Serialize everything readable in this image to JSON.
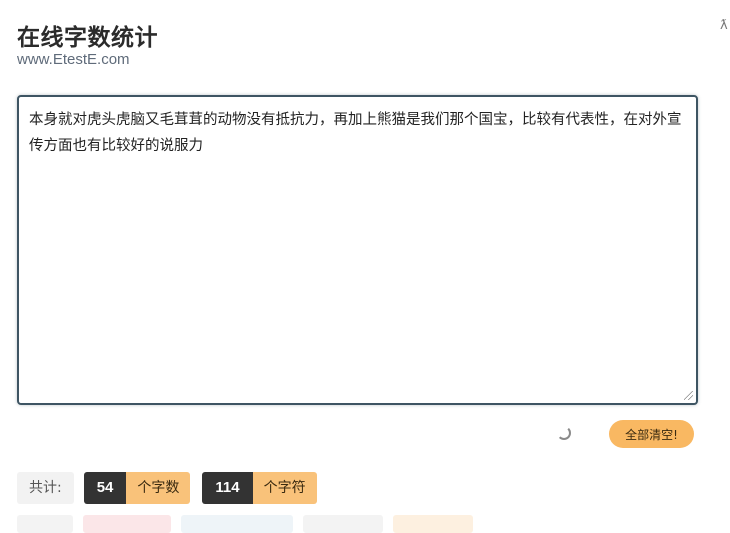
{
  "header": {
    "title": "在线字数统计",
    "subtitle": "www.EtestE.com",
    "corner_glyph": "ƛ"
  },
  "editor": {
    "text": "本身就对虎头虎脑又毛茸茸的动物没有抵抗力，再加上熊猫是我们那个国宝，比较有代表性，在对外宣传方面也有比较好的说服力"
  },
  "actions": {
    "clear_label": "全部清空!"
  },
  "stats": {
    "total_label": "共计:",
    "char_count": "54",
    "char_unit": "个字数",
    "symbol_count": "114",
    "symbol_unit": "个字符"
  },
  "colors": {
    "accent": "#f9b862",
    "dark": "#333333",
    "border": "#3e5563"
  }
}
